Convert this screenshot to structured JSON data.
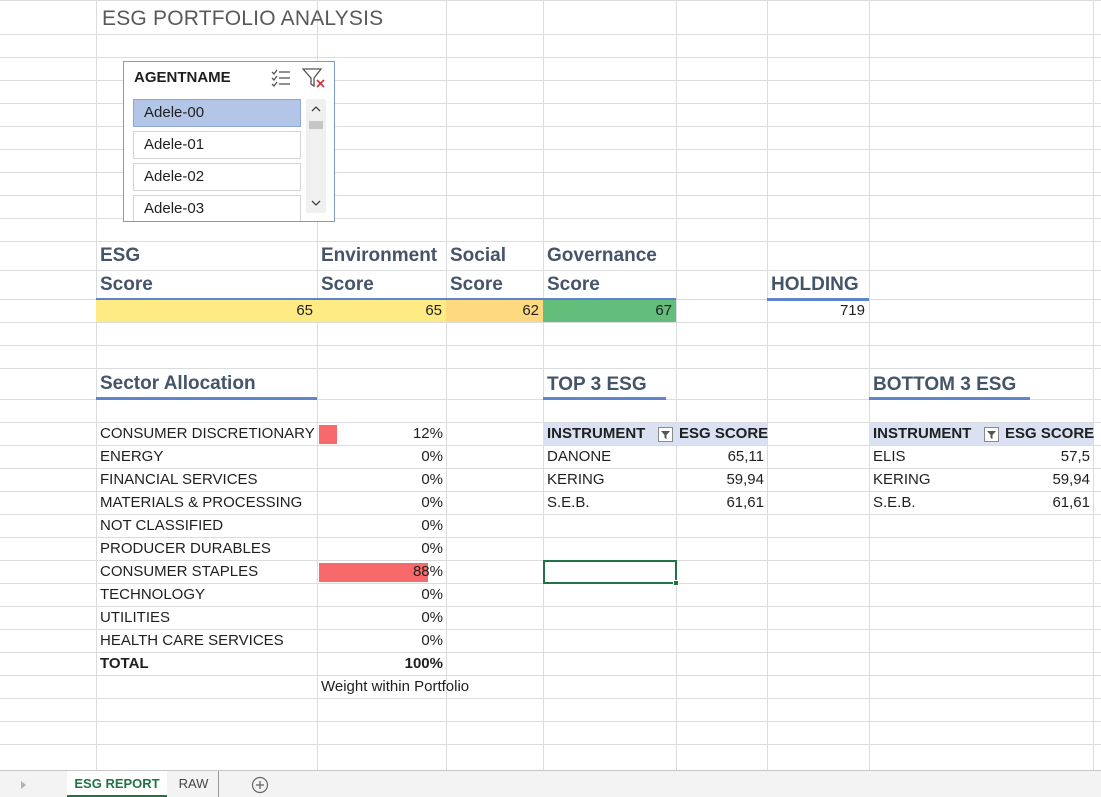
{
  "report_title": "ESG PORTFOLIO ANALYSIS",
  "slicer": {
    "header": "AGENTNAME",
    "items": [
      "Adele-00",
      "Adele-01",
      "Adele-02",
      "Adele-03"
    ],
    "selected": "Adele-00"
  },
  "scores": {
    "esg": {
      "line1": "ESG",
      "line2": "Score",
      "value": "65"
    },
    "environment": {
      "line1": "Environment",
      "line2": "Score",
      "value": "65"
    },
    "social": {
      "line1": "Social",
      "line2": "Score",
      "value": "62"
    },
    "governance": {
      "line1": "Governance",
      "line2": "Score",
      "value": "67"
    },
    "holding": {
      "label": "HOLDING",
      "value": "719"
    }
  },
  "sector_allocation": {
    "title": "Sector Allocation",
    "rows": [
      {
        "sector": "CONSUMER DISCRETIONARY",
        "pct": "12%",
        "weight": 0.12
      },
      {
        "sector": "ENERGY",
        "pct": "0%",
        "weight": 0
      },
      {
        "sector": "FINANCIAL SERVICES",
        "pct": "0%",
        "weight": 0
      },
      {
        "sector": "MATERIALS & PROCESSING",
        "pct": "0%",
        "weight": 0
      },
      {
        "sector": "NOT CLASSIFIED",
        "pct": "0%",
        "weight": 0
      },
      {
        "sector": "PRODUCER DURABLES",
        "pct": "0%",
        "weight": 0
      },
      {
        "sector": "CONSUMER STAPLES",
        "pct": "88%",
        "weight": 0.88
      },
      {
        "sector": "TECHNOLOGY",
        "pct": "0%",
        "weight": 0
      },
      {
        "sector": "UTILITIES",
        "pct": "0%",
        "weight": 0
      },
      {
        "sector": "HEALTH CARE SERVICES",
        "pct": "0%",
        "weight": 0
      }
    ],
    "total_label": "TOTAL",
    "total_pct": "100%",
    "footnote": "Weight within Portfolio"
  },
  "top3": {
    "title": "TOP 3 ESG",
    "col1": "INSTRUMENT",
    "col2": "ESG SCORE",
    "rows": [
      {
        "instrument": "DANONE",
        "score": "65,11"
      },
      {
        "instrument": "KERING",
        "score": "59,94"
      },
      {
        "instrument": "S.E.B.",
        "score": "61,61"
      }
    ]
  },
  "bottom3": {
    "title": "BOTTOM 3 ESG",
    "col1": "INSTRUMENT",
    "col2": "ESG SCORE",
    "rows": [
      {
        "instrument": "ELIS",
        "score": "57,5"
      },
      {
        "instrument": "KERING",
        "score": "59,94"
      },
      {
        "instrument": "S.E.B.",
        "score": "61,61"
      }
    ]
  },
  "sheet_tabs": {
    "active": "ESG REPORT",
    "other": "RAW"
  },
  "colors": {
    "esg_fill": "#ffeb84",
    "environment_fill": "#ffeb84",
    "social_fill": "#ffd97f",
    "governance_fill": "#63be7b",
    "bar_fill": "#f8696b",
    "table_header": "#d9e1f2",
    "accent": "#217346"
  }
}
